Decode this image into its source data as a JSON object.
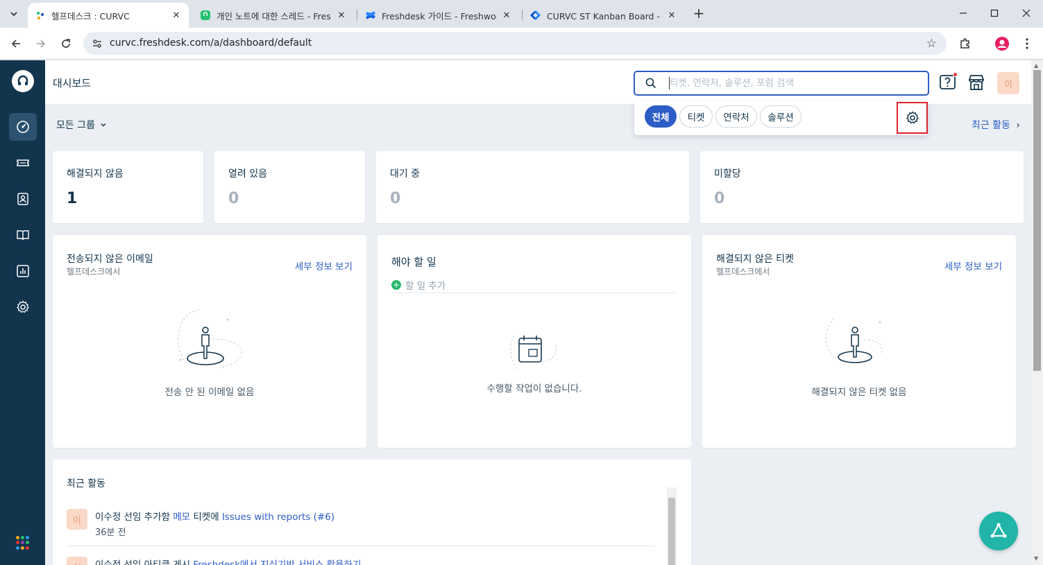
{
  "browser": {
    "tabs": [
      {
        "title": "헬프데스크 : CURVC",
        "active": true
      },
      {
        "title": "개인 노트에 대한 스레드 - Fres",
        "active": false
      },
      {
        "title": "Freshdesk 가이드 - Freshworks",
        "active": false
      },
      {
        "title": "CURVC ST Kanban Board - 애자",
        "active": false
      }
    ],
    "new_tab": "+",
    "url": "curvc.freshdesk.com/a/dashboard/default"
  },
  "header": {
    "title": "대시보드",
    "search_placeholder": "티켓, 연락처, 솔루션, 포럼 검색",
    "avatar_initial": "이"
  },
  "search_dropdown": {
    "chips": [
      "전체",
      "티켓",
      "연락처",
      "솔루션"
    ],
    "selected": "전체"
  },
  "subbar": {
    "group_filter": "모든 그룹",
    "recent_activity_link": "최근 활동"
  },
  "stats": [
    {
      "label": "해결되지 않음",
      "value": "1",
      "color": "#12344d"
    },
    {
      "label": "열려 있음",
      "value": "0",
      "color": "#a7b3bf"
    },
    {
      "label": "대기 중",
      "value": "0",
      "color": "#a7b3bf"
    },
    {
      "label": "미할당",
      "value": "0",
      "color": "#a7b3bf"
    }
  ],
  "widgets": {
    "unsent_email": {
      "title": "전송되지 않은 이메일",
      "subtitle": "헬프데스크에서",
      "link": "세부 정보 보기",
      "empty": "전송 안 된 이메일 없음"
    },
    "todo": {
      "title": "해야 할 일",
      "add": "할 일 추가",
      "empty": "수행할 작업이 없습니다."
    },
    "unresolved": {
      "title": "해결되지 않은 티켓",
      "subtitle": "헬프데스크에서",
      "link": "세부 정보 보기",
      "empty": "해결되지 않은 티켓 없음"
    }
  },
  "recent_activity": {
    "title": "최근 활동",
    "items": [
      {
        "avatar": "이",
        "actor": "이수정 선임 추가함",
        "middle": "메모",
        "rest": "티켓에",
        "target": "Issues with reports (#6)",
        "time": "36분 전"
      },
      {
        "avatar": "이",
        "actor": "이수정 선임 아티클 게시",
        "middle": "",
        "rest": "",
        "target": "Freshdesk에서 지식기반 서비스 활용하기",
        "time": ""
      }
    ]
  },
  "colors": {
    "sidebar": "#12344d",
    "accent": "#2c5cc5",
    "highlight_box": "#d8232a",
    "fab": "#20b5a8"
  }
}
